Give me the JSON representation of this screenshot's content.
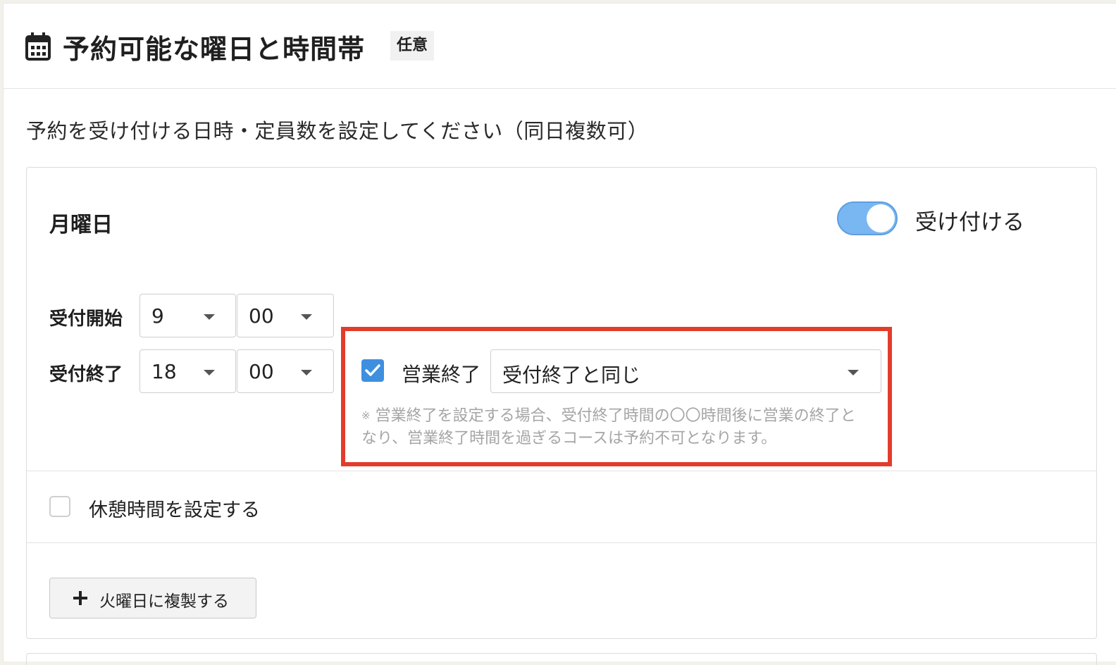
{
  "section": {
    "title": "予約可能な曜日と時間帯",
    "badge": "任意",
    "icon": "calendar-icon",
    "description": "予約を受け付ける日時・定員数を設定してください（同日複数可）"
  },
  "day": {
    "name": "月曜日",
    "toggle_label": "受け付ける",
    "toggle_on": true,
    "start_label": "受付開始",
    "start_hour": "9",
    "start_minute": "00",
    "end_label": "受付終了",
    "end_hour": "18",
    "end_minute": "00",
    "business_end": {
      "checked": true,
      "label": "営業終了",
      "selected": "受付終了と同じ",
      "note_mark": "※",
      "note": "営業終了を設定する場合、受付終了時間の〇〇時間後に営業の終了となり、営業終了時間を過ぎるコースは予約不可となります。"
    },
    "break_time": {
      "checked": false,
      "label": "休憩時間を設定する"
    },
    "copy_button_label": "火曜日に複製する"
  },
  "colors": {
    "accent": "#3f8fe0",
    "toggle": "#79b7f2",
    "highlight": "#e33c2b",
    "note_text": "#a5a5a5"
  }
}
